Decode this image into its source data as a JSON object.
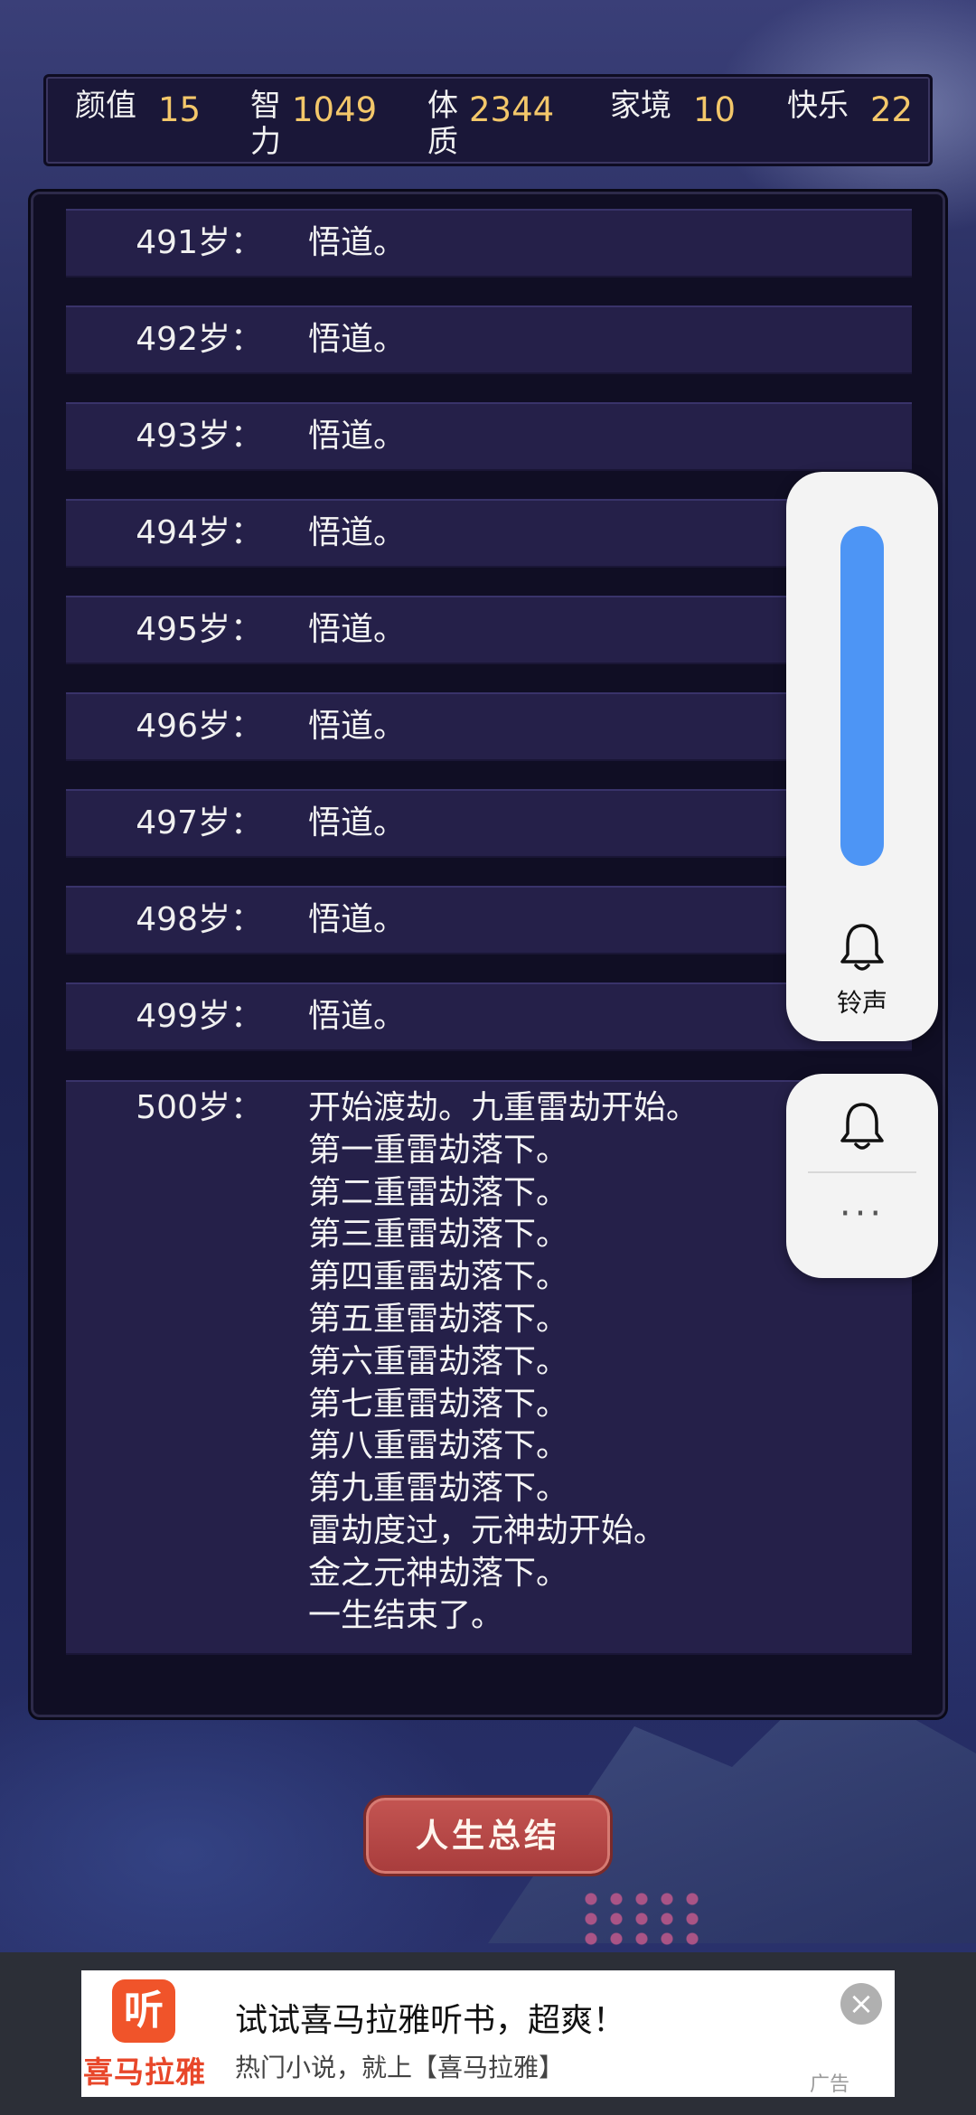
{
  "stats": [
    {
      "label": "颜值",
      "value": "15"
    },
    {
      "label": "智力",
      "value": "1049"
    },
    {
      "label": "体质",
      "value": "2344"
    },
    {
      "label": "家境",
      "value": "10"
    },
    {
      "label": "快乐",
      "value": "22"
    }
  ],
  "log": [
    {
      "age": "491岁：",
      "text": "悟道。"
    },
    {
      "age": "492岁：",
      "text": "悟道。"
    },
    {
      "age": "493岁：",
      "text": "悟道。"
    },
    {
      "age": "494岁：",
      "text": "悟道。"
    },
    {
      "age": "495岁：",
      "text": "悟道。"
    },
    {
      "age": "496岁：",
      "text": "悟道。"
    },
    {
      "age": "497岁：",
      "text": "悟道。"
    },
    {
      "age": "498岁：",
      "text": "悟道。"
    },
    {
      "age": "499岁：",
      "text": "悟道。"
    }
  ],
  "final_entry": {
    "age": "500岁：",
    "lines": [
      "开始渡劫。九重雷劫开始。",
      "第一重雷劫落下。",
      "第二重雷劫落下。",
      "第三重雷劫落下。",
      "第四重雷劫落下。",
      "第五重雷劫落下。",
      "第六重雷劫落下。",
      "第七重雷劫落下。",
      "第八重雷劫落下。",
      "第九重雷劫落下。",
      "雷劫度过，元神劫开始。",
      "金之元神劫落下。",
      "一生结束了。"
    ]
  },
  "volume_panel": {
    "ringtone_label": "铃声",
    "more_label": "···",
    "level": 1.0,
    "accent_color": "#4d95f5"
  },
  "summary_button": {
    "label": "人生总结"
  },
  "ad": {
    "logo_glyph": "听",
    "logo_text": "喜马拉雅",
    "title": "试试喜马拉雅听书，超爽！",
    "subtitle": "热门小说，就上【喜马拉雅】",
    "close_label": "×",
    "tag": "广告"
  }
}
